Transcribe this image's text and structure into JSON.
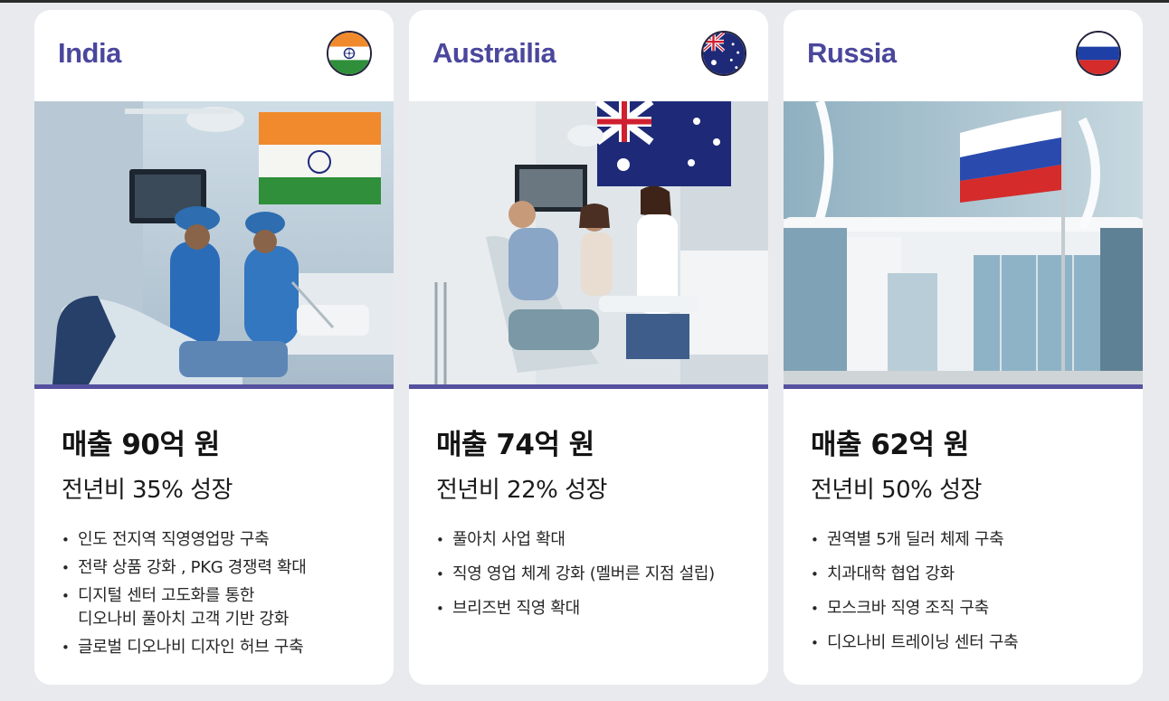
{
  "theme": {
    "accent": "#4b479c",
    "bar": "#55519f"
  },
  "cards": [
    {
      "country": "India",
      "flag_icon": "india-flag-icon",
      "photo_icon": "dental-clinic-india-photo",
      "sales": "매출 90억 원",
      "growth": "전년비 35% 성장",
      "bullets": [
        "인도 전지역 직영영업망 구축",
        "전략 상품 강화 , PKG 경쟁력 확대",
        "디지털 센터 고도화를 통한\n디오나비 풀아치 고객 기반 강화",
        "글로벌 디오나비 디자인 허브 구축"
      ]
    },
    {
      "country": "Austrailia",
      "flag_icon": "australia-flag-icon",
      "photo_icon": "dental-clinic-australia-photo",
      "sales": "매출 74억 원",
      "growth": "전년비 22% 성장",
      "bullets": [
        "풀아치 사업 확대",
        "직영 영업 체계 강화 (멜버른 지점 설립)",
        "브리즈번 직영 확대"
      ]
    },
    {
      "country": "Russia",
      "flag_icon": "russia-flag-icon",
      "photo_icon": "office-building-russia-photo",
      "sales": "매출 62억 원",
      "growth": "전년비 50% 성장",
      "bullets": [
        "권역별 5개 딜러 체제 구축",
        "치과대학 협업 강화",
        "모스크바 직영 조직 구축",
        "디오나비 트레이닝 센터 구축"
      ]
    }
  ]
}
